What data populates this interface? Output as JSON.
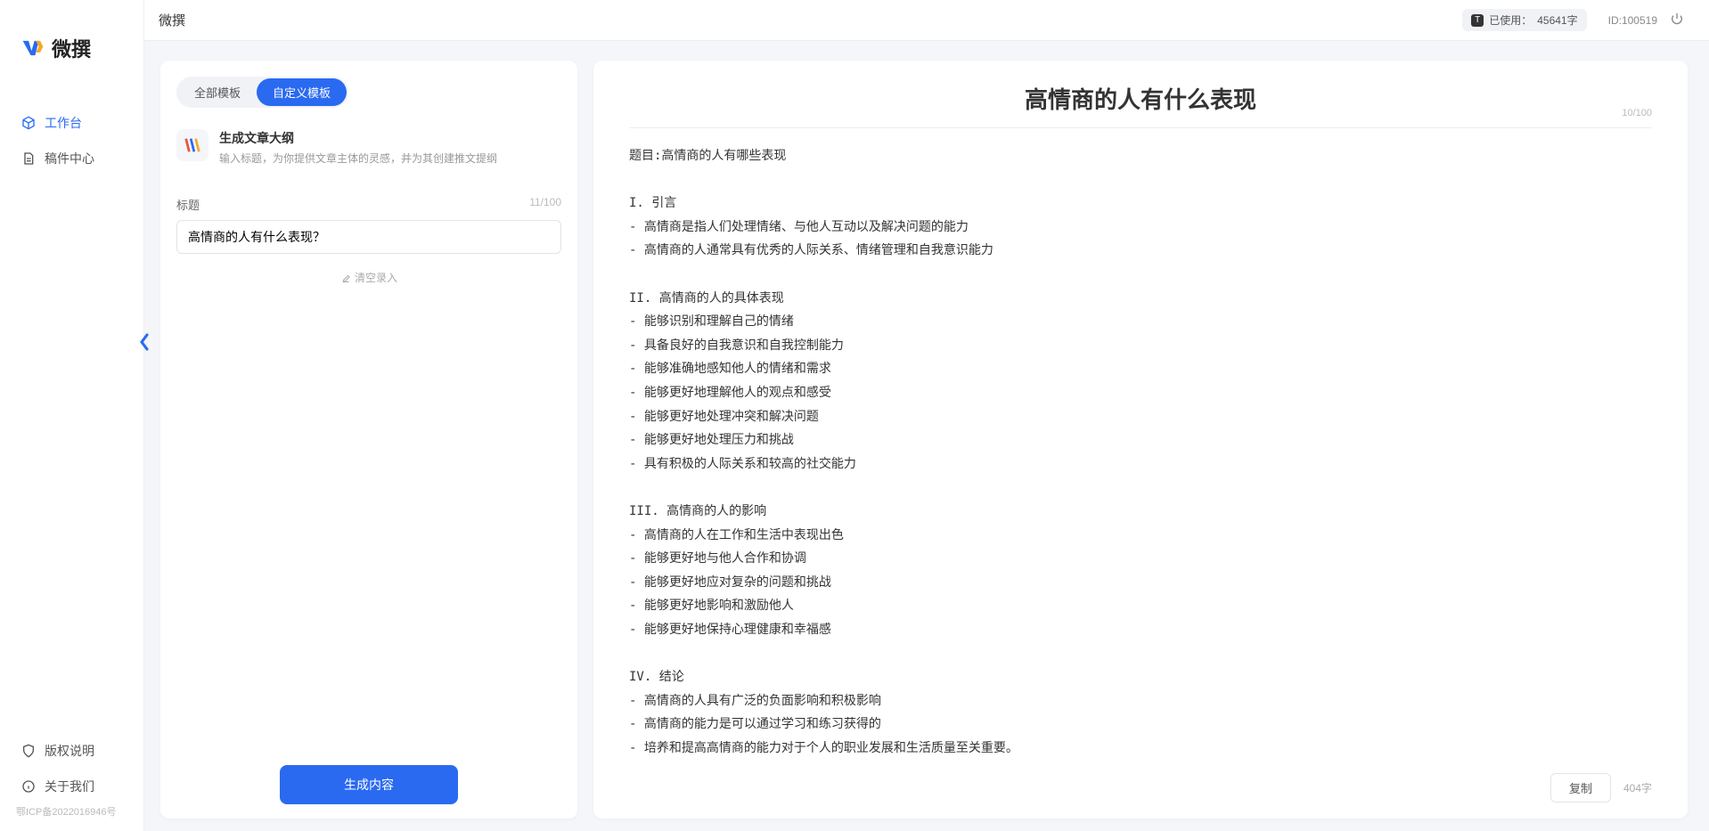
{
  "app_name": "微撰",
  "topbar": {
    "title": "微撰",
    "usage_label": "已使用：",
    "usage_value": "45641字",
    "id_label": "ID:",
    "id_value": "100519"
  },
  "sidebar": {
    "nav": [
      {
        "label": "工作台",
        "active": true
      },
      {
        "label": "稿件中心",
        "active": false
      }
    ],
    "bottom": [
      {
        "label": "版权说明"
      },
      {
        "label": "关于我们"
      }
    ],
    "icp": "鄂ICP备2022016946号"
  },
  "left": {
    "tabs": [
      {
        "label": "全部模板",
        "active": false
      },
      {
        "label": "自定义模板",
        "active": true
      }
    ],
    "template": {
      "title": "生成文章大纲",
      "subtitle": "输入标题，为你提供文章主体的灵感，并为其创建推文提纲"
    },
    "field": {
      "label": "标题",
      "counter": "11/100",
      "value": "高情商的人有什么表现？"
    },
    "clear_hint": "清空录入",
    "generate_btn": "生成内容"
  },
  "right": {
    "title": "高情商的人有什么表现",
    "title_counter": "10/100",
    "body": "题目:高情商的人有哪些表现\n\nI. 引言\n- 高情商是指人们处理情绪、与他人互动以及解决问题的能力\n- 高情商的人通常具有优秀的人际关系、情绪管理和自我意识能力\n\nII. 高情商的人的具体表现\n- 能够识别和理解自己的情绪\n- 具备良好的自我意识和自我控制能力\n- 能够准确地感知他人的情绪和需求\n- 能够更好地理解他人的观点和感受\n- 能够更好地处理冲突和解决问题\n- 能够更好地处理压力和挑战\n- 具有积极的人际关系和较高的社交能力\n\nIII. 高情商的人的影响\n- 高情商的人在工作和生活中表现出色\n- 能够更好地与他人合作和协调\n- 能够更好地应对复杂的问题和挑战\n- 能够更好地影响和激励他人\n- 能够更好地保持心理健康和幸福感\n\nIV. 结论\n- 高情商的人具有广泛的负面影响和积极影响\n- 高情商的能力是可以通过学习和练习获得的\n- 培养和提高高情商的能力对于个人的职业发展和生活质量至关重要。",
    "copy_btn": "复制",
    "word_count": "404字"
  }
}
